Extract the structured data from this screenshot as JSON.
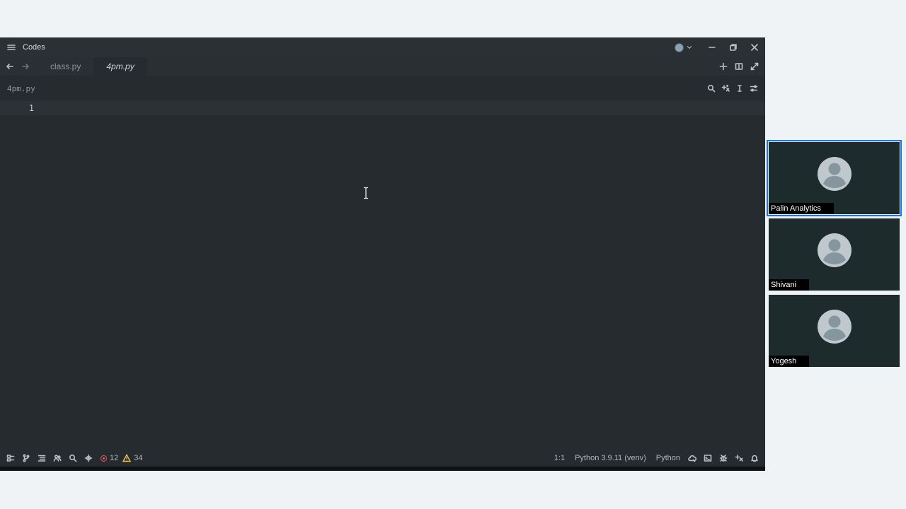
{
  "window": {
    "title": "Codes",
    "tabs": [
      {
        "label": "class.py",
        "active": false
      },
      {
        "label": "4pm.py",
        "active": true
      }
    ],
    "file_path": "4pm.py",
    "editor": {
      "line_numbers": [
        "1"
      ]
    },
    "status": {
      "errors": "12",
      "warnings": "34",
      "cursor_position": "1:1",
      "interpreter": "Python 3.9.11 (venv)",
      "language": "Python"
    },
    "icons": {
      "titlebar": [
        "hamburger-menu-icon",
        "user-avatar-icon",
        "chevron-down-icon",
        "minimize-icon",
        "restore-icon",
        "close-icon"
      ],
      "tabbar": [
        "arrow-left-icon",
        "arrow-right-icon",
        "plus-icon",
        "split-view-icon",
        "expand-icon"
      ],
      "pathbar": [
        "search-icon",
        "sparkle-icon",
        "text-cursor-icon",
        "settings-sliders-icon"
      ]
    },
    "colors": {
      "error": "#e35b5b",
      "warning": "#e7c15a",
      "background": "#262b30"
    }
  },
  "participants": [
    {
      "name": "Palin Analytics",
      "speaking": true
    },
    {
      "name": "Shivani",
      "speaking": false
    },
    {
      "name": "Yogesh",
      "speaking": false
    }
  ],
  "colors": {
    "active_speaker_border": "#1a73e8",
    "page_background": "#eff3f6"
  }
}
